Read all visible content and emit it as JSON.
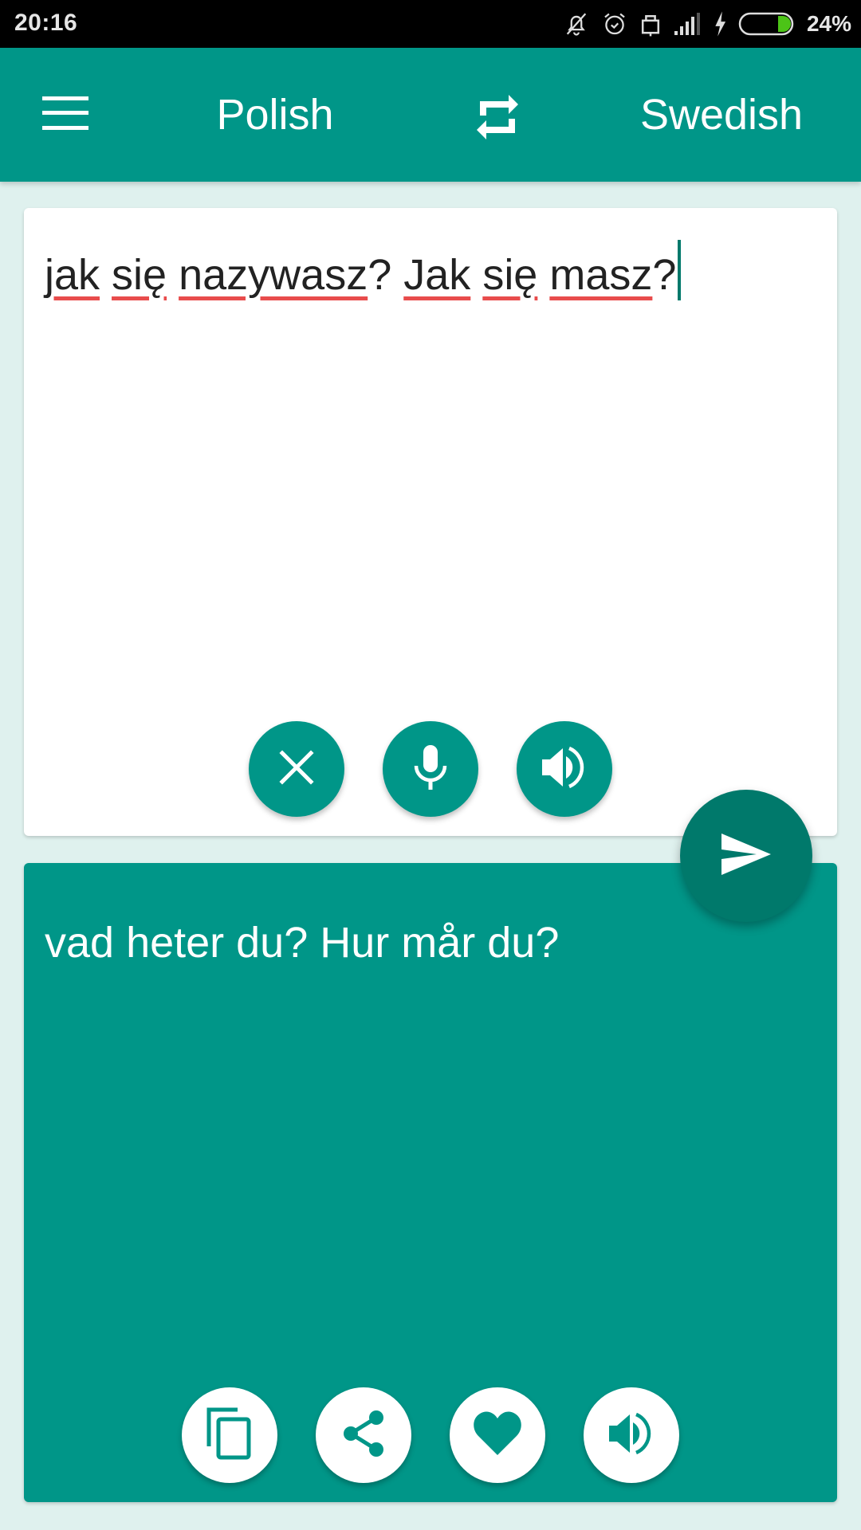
{
  "status_bar": {
    "time": "20:16",
    "icons": [
      "notifications-off-icon",
      "alarm-icon",
      "lock-icon",
      "signal-icon",
      "charging-icon",
      "battery-icon"
    ],
    "battery_percent": "24%",
    "battery_level": 0.24,
    "battery_color": "#4cc417"
  },
  "app_bar": {
    "menu_icon": "hamburger-menu-icon",
    "source_language": "Polish",
    "swap_icon": "swap-languages-icon",
    "target_language": "Swedish",
    "color": "#009688"
  },
  "input": {
    "words": [
      "jak",
      "się",
      "nazywasz",
      "?",
      "Jak",
      "się",
      "masz",
      "?"
    ],
    "text": "jak się nazywasz? Jak się masz?",
    "actions": [
      {
        "name": "clear",
        "icon": "close-icon"
      },
      {
        "name": "voice-input",
        "icon": "microphone-icon"
      },
      {
        "name": "speak-source",
        "icon": "speaker-icon"
      }
    ]
  },
  "translate_button": {
    "icon": "send-icon",
    "color": "#00796b"
  },
  "output": {
    "text": "vad heter du? Hur mår du?",
    "actions": [
      {
        "name": "copy",
        "icon": "copy-icon"
      },
      {
        "name": "share",
        "icon": "share-icon"
      },
      {
        "name": "favorite",
        "icon": "heart-icon"
      },
      {
        "name": "speak-translation",
        "icon": "speaker-icon"
      }
    ]
  }
}
